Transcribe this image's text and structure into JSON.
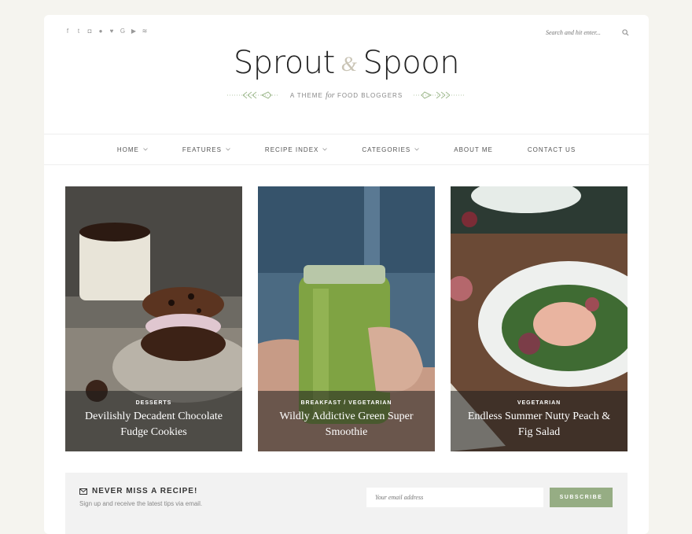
{
  "site": {
    "logo_left": "Sprout",
    "logo_amp": "&",
    "logo_right": "Spoon",
    "tagline_pre": "A THEME",
    "tagline_em": "for",
    "tagline_post": "FOOD BLOGGERS"
  },
  "social_icons": [
    "facebook-icon",
    "twitter-icon",
    "instagram-icon",
    "pinterest-icon",
    "heart-icon",
    "google-plus-icon",
    "youtube-icon",
    "rss-icon"
  ],
  "search": {
    "placeholder": "Search and hit enter..."
  },
  "nav": [
    {
      "label": "HOME",
      "dropdown": true
    },
    {
      "label": "FEATURES",
      "dropdown": true
    },
    {
      "label": "RECIPE INDEX",
      "dropdown": true
    },
    {
      "label": "CATEGORIES",
      "dropdown": true
    },
    {
      "label": "ABOUT ME",
      "dropdown": false
    },
    {
      "label": "CONTACT US",
      "dropdown": false
    }
  ],
  "cards": [
    {
      "cats": "DESSERTS",
      "title": "Devilishly Decadent Chocolate Fudge Cookies"
    },
    {
      "cats": "BREAKFAST / VEGETARIAN",
      "title": "Wildly Addictive Green Super Smoothie"
    },
    {
      "cats": "VEGETARIAN",
      "title": "Endless Summer Nutty Peach & Fig Salad"
    }
  ],
  "newsletter": {
    "heading": "NEVER MISS A RECIPE!",
    "subtext": "Sign up and receive the latest tips via email.",
    "placeholder": "Your email address",
    "button": "SUBSCRIBE"
  },
  "colors": {
    "accent": "#96ad84",
    "page_bg": "#f5f4ef"
  }
}
